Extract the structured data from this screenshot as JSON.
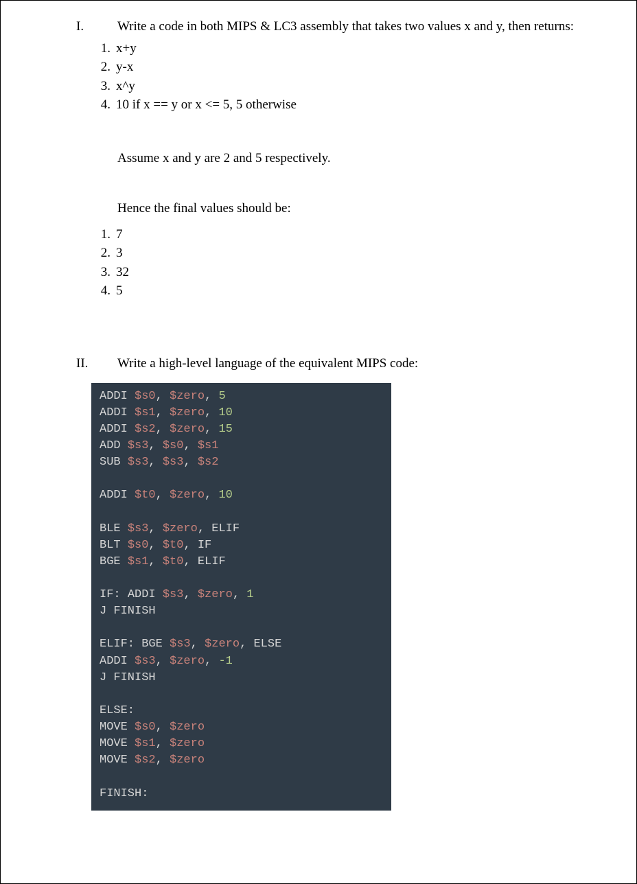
{
  "section1": {
    "roman": "I.",
    "prompt": "Write a code in both MIPS & LC3 assembly that takes two values x and y, then returns:",
    "items": [
      {
        "num": "1.",
        "text": "x+y"
      },
      {
        "num": "2.",
        "text": "y-x"
      },
      {
        "num": "3.",
        "text": "x^y"
      },
      {
        "num": "4.",
        "text": "10 if x == y  or x <= 5, 5 otherwise"
      }
    ],
    "assume": "Assume x and y are 2 and 5 respectively.",
    "hence": "Hence the final values should be:",
    "results": [
      {
        "num": "1.",
        "text": "7"
      },
      {
        "num": "2.",
        "text": "3"
      },
      {
        "num": "3.",
        "text": "32"
      },
      {
        "num": "4.",
        "text": "5"
      }
    ]
  },
  "section2": {
    "roman": "II.",
    "prompt": "Write a high-level language of the equivalent MIPS code:",
    "code": {
      "lines": [
        [
          {
            "t": "op",
            "v": "ADDI "
          },
          {
            "t": "reg",
            "v": "$s0"
          },
          {
            "t": "p",
            "v": ", "
          },
          {
            "t": "reg",
            "v": "$zero"
          },
          {
            "t": "p",
            "v": ", "
          },
          {
            "t": "num",
            "v": "5"
          }
        ],
        [
          {
            "t": "op",
            "v": "ADDI "
          },
          {
            "t": "reg",
            "v": "$s1"
          },
          {
            "t": "p",
            "v": ", "
          },
          {
            "t": "reg",
            "v": "$zero"
          },
          {
            "t": "p",
            "v": ", "
          },
          {
            "t": "num",
            "v": "10"
          }
        ],
        [
          {
            "t": "op",
            "v": "ADDI "
          },
          {
            "t": "reg",
            "v": "$s2"
          },
          {
            "t": "p",
            "v": ", "
          },
          {
            "t": "reg",
            "v": "$zero"
          },
          {
            "t": "p",
            "v": ", "
          },
          {
            "t": "num",
            "v": "15"
          }
        ],
        [
          {
            "t": "op",
            "v": "ADD "
          },
          {
            "t": "reg",
            "v": "$s3"
          },
          {
            "t": "p",
            "v": ", "
          },
          {
            "t": "reg",
            "v": "$s0"
          },
          {
            "t": "p",
            "v": ", "
          },
          {
            "t": "reg",
            "v": "$s1"
          }
        ],
        [
          {
            "t": "op",
            "v": "SUB "
          },
          {
            "t": "reg",
            "v": "$s3"
          },
          {
            "t": "p",
            "v": ", "
          },
          {
            "t": "reg",
            "v": "$s3"
          },
          {
            "t": "p",
            "v": ", "
          },
          {
            "t": "reg",
            "v": "$s2"
          }
        ],
        [],
        [
          {
            "t": "op",
            "v": "ADDI "
          },
          {
            "t": "reg",
            "v": "$t0"
          },
          {
            "t": "p",
            "v": ", "
          },
          {
            "t": "reg",
            "v": "$zero"
          },
          {
            "t": "p",
            "v": ", "
          },
          {
            "t": "num",
            "v": "10"
          }
        ],
        [],
        [
          {
            "t": "op",
            "v": "BLE "
          },
          {
            "t": "reg",
            "v": "$s3"
          },
          {
            "t": "p",
            "v": ", "
          },
          {
            "t": "reg",
            "v": "$zero"
          },
          {
            "t": "p",
            "v": ", "
          },
          {
            "t": "lbl",
            "v": "ELIF"
          }
        ],
        [
          {
            "t": "op",
            "v": "BLT "
          },
          {
            "t": "reg",
            "v": "$s0"
          },
          {
            "t": "p",
            "v": ", "
          },
          {
            "t": "reg",
            "v": "$t0"
          },
          {
            "t": "p",
            "v": ", "
          },
          {
            "t": "lbl",
            "v": "IF"
          }
        ],
        [
          {
            "t": "op",
            "v": "BGE "
          },
          {
            "t": "reg",
            "v": "$s1"
          },
          {
            "t": "p",
            "v": ", "
          },
          {
            "t": "reg",
            "v": "$t0"
          },
          {
            "t": "p",
            "v": ", "
          },
          {
            "t": "lbl",
            "v": "ELIF"
          }
        ],
        [],
        [
          {
            "t": "lbldef",
            "v": "IF: "
          },
          {
            "t": "op",
            "v": "ADDI "
          },
          {
            "t": "reg",
            "v": "$s3"
          },
          {
            "t": "p",
            "v": ", "
          },
          {
            "t": "reg",
            "v": "$zero"
          },
          {
            "t": "p",
            "v": ", "
          },
          {
            "t": "num",
            "v": "1"
          }
        ],
        [
          {
            "t": "op",
            "v": "J "
          },
          {
            "t": "lbl",
            "v": "FINISH"
          }
        ],
        [],
        [
          {
            "t": "lbldef",
            "v": "ELIF: "
          },
          {
            "t": "op",
            "v": "BGE "
          },
          {
            "t": "reg",
            "v": "$s3"
          },
          {
            "t": "p",
            "v": ", "
          },
          {
            "t": "reg",
            "v": "$zero"
          },
          {
            "t": "p",
            "v": ", "
          },
          {
            "t": "lbl",
            "v": "ELSE"
          }
        ],
        [
          {
            "t": "op",
            "v": "ADDI "
          },
          {
            "t": "reg",
            "v": "$s3"
          },
          {
            "t": "p",
            "v": ", "
          },
          {
            "t": "reg",
            "v": "$zero"
          },
          {
            "t": "p",
            "v": ", "
          },
          {
            "t": "num",
            "v": "-1"
          }
        ],
        [
          {
            "t": "op",
            "v": "J "
          },
          {
            "t": "lbl",
            "v": "FINISH"
          }
        ],
        [],
        [
          {
            "t": "lbldef",
            "v": "ELSE:"
          }
        ],
        [
          {
            "t": "op",
            "v": "MOVE "
          },
          {
            "t": "reg",
            "v": "$s0"
          },
          {
            "t": "p",
            "v": ", "
          },
          {
            "t": "reg",
            "v": "$zero"
          }
        ],
        [
          {
            "t": "op",
            "v": "MOVE "
          },
          {
            "t": "reg",
            "v": "$s1"
          },
          {
            "t": "p",
            "v": ", "
          },
          {
            "t": "reg",
            "v": "$zero"
          }
        ],
        [
          {
            "t": "op",
            "v": "MOVE "
          },
          {
            "t": "reg",
            "v": "$s2"
          },
          {
            "t": "p",
            "v": ", "
          },
          {
            "t": "reg",
            "v": "$zero"
          }
        ],
        [],
        [
          {
            "t": "lbldef",
            "v": "FINISH:"
          }
        ]
      ]
    }
  }
}
